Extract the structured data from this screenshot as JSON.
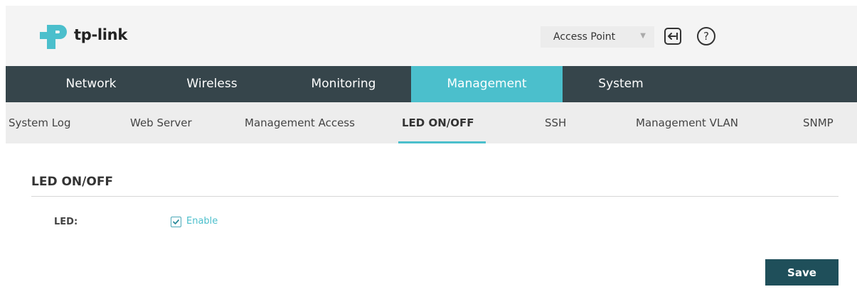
{
  "header": {
    "logo_text": "tp-link",
    "mode_select": "Access Point",
    "brand_color": "#4bbfcc"
  },
  "main_nav": [
    {
      "label": "Network"
    },
    {
      "label": "Wireless"
    },
    {
      "label": "Monitoring"
    },
    {
      "label": "Management",
      "active": true
    },
    {
      "label": "System"
    }
  ],
  "sub_nav": [
    {
      "label": "System Log"
    },
    {
      "label": "Web Server"
    },
    {
      "label": "Management Access"
    },
    {
      "label": "LED ON/OFF",
      "active": true
    },
    {
      "label": "SSH"
    },
    {
      "label": "Management VLAN"
    },
    {
      "label": "SNMP"
    }
  ],
  "content": {
    "section_title": "LED ON/OFF",
    "led_label": "LED:",
    "enable_label": "Enable",
    "enable_checked": true,
    "save_label": "Save"
  },
  "icons": {
    "logout": "logout-icon",
    "help": "help-icon",
    "dropdown": "chevron-down-icon",
    "check": "check-icon"
  }
}
